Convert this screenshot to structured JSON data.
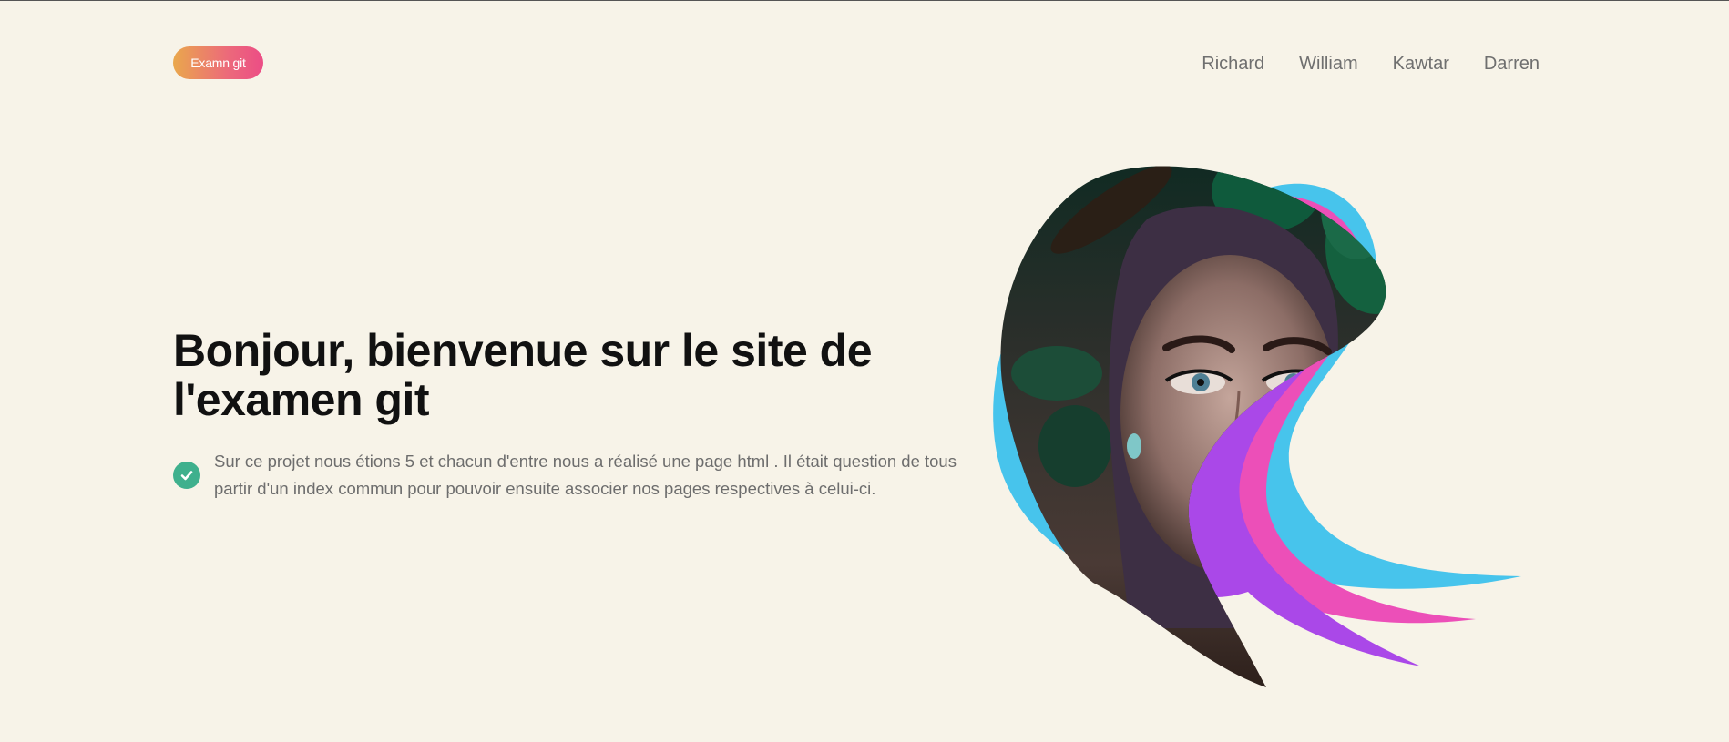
{
  "header": {
    "logo_label": "Examn git",
    "nav": [
      {
        "label": "Richard"
      },
      {
        "label": "William"
      },
      {
        "label": "Kawtar"
      },
      {
        "label": "Darren"
      }
    ]
  },
  "hero": {
    "title": "Bonjour, bienvenue sur le site de l'examen git",
    "feature_text": "Sur ce projet nous étions 5 et chacun d'entre nous a réalisé une page html . Il était question de tous partir d'un index commun pour pouvoir ensuite associer nos pages respectives à celui-ci.",
    "image_icon": "portrait-image"
  },
  "colors": {
    "background": "#f7f3e8",
    "accent_green": "#3fb08d",
    "ribbon_blue": "#47c4ec",
    "ribbon_pink": "#ec4fb8",
    "ribbon_purple": "#aa48e8"
  }
}
